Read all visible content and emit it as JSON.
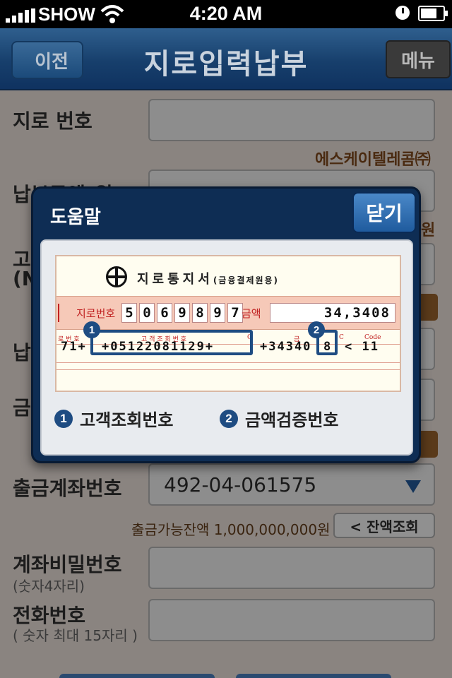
{
  "status_bar": {
    "carrier": "SHOW",
    "time": "4:20 AM"
  },
  "nav": {
    "back_label": "이전",
    "title": "지로입력납부",
    "menu_label": "메뉴"
  },
  "form": {
    "giro_no_label": "지로 번호",
    "biller_name": "에스케이텔레콤㈜",
    "amount_label": "납부금액(원)",
    "amount_unit": "원",
    "customer_label_prefix": "고객",
    "customer_label_sub": "(N",
    "payment_label_prefix": "납부",
    "amount_verify_label_prefix": "금액",
    "withdraw_account_label": "출금계좌번호",
    "withdraw_account_value": "492-04-061575",
    "available_balance": "출금가능잔액 1,000,000,000원",
    "balance_button": "< 잔액조회",
    "password_label": "계좌비밀번호",
    "password_hint": "(숫자4자리)",
    "phone_label": "전화번호",
    "phone_hint": "( 숫자 최대 15자리 )"
  },
  "modal": {
    "title": "도움말",
    "close_label": "닫기",
    "giro": {
      "title": "지로통지서",
      "title_sub": "(금융결제원용)",
      "number_label": "지로번호",
      "number_digits": [
        "5",
        "0",
        "6",
        "9",
        "8",
        "9",
        "7"
      ],
      "amount_label": "금액",
      "amount_value": "34,3408",
      "ocr_left": "71+",
      "ocr_customer": "+05122081129+",
      "ocr_amount": "+34340",
      "ocr_check": "8",
      "ocr_code": "< 11",
      "code_caption": "Code",
      "c_caption": "C",
      "customer_caption": "고 객 조 회 번 호",
      "amount_caption": "금",
      "left_caption": "로 번 호"
    },
    "legend": [
      {
        "num": "1",
        "label": "고객조회번호"
      },
      {
        "num": "2",
        "label": "금액검증번호"
      }
    ]
  }
}
